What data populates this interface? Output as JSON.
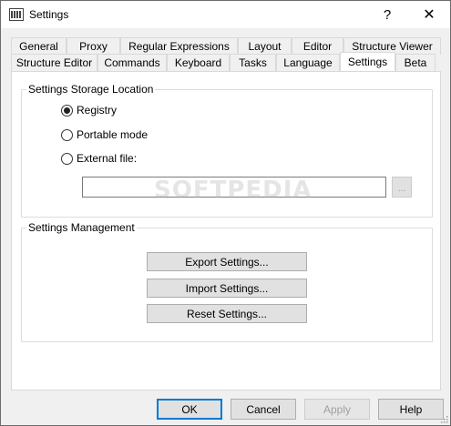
{
  "window": {
    "title": "Settings",
    "help_glyph": "?",
    "close_glyph": "✕"
  },
  "tabs": {
    "row1": [
      "General",
      "Proxy",
      "Regular Expressions",
      "Layout",
      "Editor",
      "Structure Viewer"
    ],
    "row2": [
      "Structure Editor",
      "Commands",
      "Keyboard",
      "Tasks",
      "Language",
      "Settings",
      "Beta"
    ],
    "active": "Settings"
  },
  "storage": {
    "title": "Settings Storage Location",
    "options": [
      {
        "label": "Registry",
        "checked": true
      },
      {
        "label": "Portable mode",
        "checked": false
      },
      {
        "label": "External file:",
        "checked": false
      }
    ],
    "file_value": "",
    "browse_label": "..."
  },
  "management": {
    "title": "Settings Management",
    "export_label": "Export Settings...",
    "import_label": "Import Settings...",
    "reset_label": "Reset Settings..."
  },
  "footer": {
    "ok": "OK",
    "cancel": "Cancel",
    "apply": "Apply",
    "help": "Help"
  },
  "watermark": "SOFTPEDIA",
  "colors": {
    "accent": "#0078d7",
    "dialog_bg": "#f0f0f0",
    "panel_bg": "#ffffff"
  }
}
